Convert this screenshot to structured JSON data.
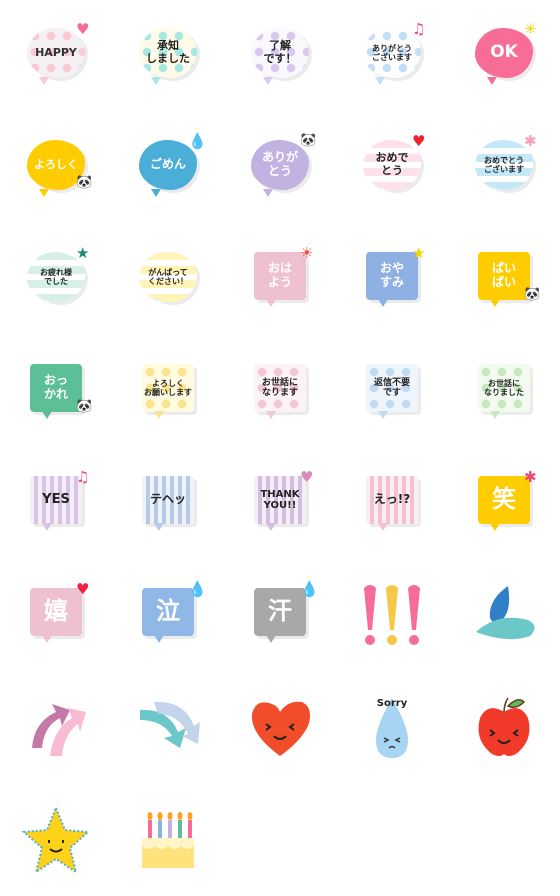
{
  "stickers": [
    {
      "lines": [
        "HAPPY"
      ],
      "shape": "cloud",
      "bg": "#f4f0f4",
      "dot": "#f9c9d4",
      "fg": "#333333",
      "size": 11,
      "pattern": "dots",
      "deco": "heart-icon",
      "decoColor": "#f56b9a"
    },
    {
      "lines": [
        "承知",
        "しました"
      ],
      "shape": "cloud",
      "bg": "#fffbe8",
      "dot": "#a8e8e4",
      "fg": "#222222",
      "size": 11,
      "pattern": "dots",
      "deco": "",
      "decoColor": ""
    },
    {
      "lines": [
        "了解",
        "です！"
      ],
      "shape": "cloud",
      "bg": "#faf8fc",
      "dot": "#d9c8f0",
      "fg": "#222222",
      "size": 11,
      "pattern": "dots",
      "deco": "",
      "decoColor": ""
    },
    {
      "lines": [
        "ありがとう",
        "ございます"
      ],
      "shape": "cloud",
      "bg": "#ffffff",
      "dot": "#c3def7",
      "fg": "#222222",
      "size": 8,
      "pattern": "dots",
      "deco": "music-note-icon",
      "decoColor": "#f0457a"
    },
    {
      "lines": [
        "OK"
      ],
      "shape": "cloud",
      "bg": "#f76d98",
      "dot": "",
      "fg": "#ffffff",
      "size": 17,
      "pattern": "solid",
      "deco": "sparkle-icon",
      "decoColor": "#f5d400"
    },
    {
      "lines": [
        "よろしく"
      ],
      "shape": "cloud",
      "bg": "#ffcc00",
      "dot": "",
      "fg": "#ffffff",
      "size": 11,
      "pattern": "solid",
      "deco": "panda-icon",
      "decoColor": "#000000"
    },
    {
      "lines": [
        "ごめん"
      ],
      "shape": "cloud",
      "bg": "#4aaed8",
      "dot": "",
      "fg": "#ffffff",
      "size": 12,
      "pattern": "solid",
      "deco": "sweat-drop-icon",
      "decoColor": "#aaaaaa"
    },
    {
      "lines": [
        "ありが",
        "とう"
      ],
      "shape": "cloud",
      "bg": "#c2b2e2",
      "dot": "",
      "fg": "#ffffff",
      "size": 12,
      "pattern": "solid",
      "deco": "panda-icon",
      "decoColor": "#000000"
    },
    {
      "lines": [
        "おめで",
        "とう"
      ],
      "shape": "cloud",
      "bg": "#fde0ea",
      "dot": "#ffffff",
      "fg": "#222222",
      "size": 11,
      "pattern": "stripes",
      "deco": "heart-icon",
      "decoColor": "#ee2233"
    },
    {
      "lines": [
        "おめでとう",
        "ございます"
      ],
      "shape": "cloud",
      "bg": "#c4e8f7",
      "dot": "#ffffff",
      "fg": "#222222",
      "size": 8,
      "pattern": "stripes",
      "deco": "flower-icon",
      "decoColor": "#f7a0b8"
    },
    {
      "lines": [
        "お疲れ様",
        "でした"
      ],
      "shape": "cloud",
      "bg": "#d6f0e8",
      "dot": "#ffffff",
      "fg": "#222222",
      "size": 8,
      "pattern": "stripes",
      "deco": "star-icon",
      "decoColor": "#1a8a7a"
    },
    {
      "lines": [
        "がんばって",
        "ください！"
      ],
      "shape": "cloud",
      "bg": "#fff4b8",
      "dot": "#ffffff",
      "fg": "#222222",
      "size": 8,
      "pattern": "stripes",
      "deco": "",
      "decoColor": ""
    },
    {
      "lines": [
        "おは",
        "よう"
      ],
      "shape": "square",
      "bg": "#efc0d0",
      "dot": "",
      "fg": "#ffffff",
      "size": 12,
      "pattern": "solid",
      "deco": "sun-icon",
      "decoColor": "#f24d3a"
    },
    {
      "lines": [
        "おや",
        "すみ"
      ],
      "shape": "square",
      "bg": "#8fb0e2",
      "dot": "",
      "fg": "#ffffff",
      "size": 12,
      "pattern": "solid",
      "deco": "star-icon",
      "decoColor": "#f5d400"
    },
    {
      "lines": [
        "ばい",
        "ばい"
      ],
      "shape": "square",
      "bg": "#ffcc00",
      "dot": "",
      "fg": "#ffffff",
      "size": 12,
      "pattern": "solid",
      "deco": "panda-icon",
      "decoColor": "#000000"
    },
    {
      "lines": [
        "おっ",
        "かれ"
      ],
      "shape": "square",
      "bg": "#5cbf95",
      "dot": "",
      "fg": "#ffffff",
      "size": 12,
      "pattern": "solid",
      "deco": "panda-icon",
      "decoColor": "#000000"
    },
    {
      "lines": [
        "よろしく",
        "お願いします"
      ],
      "shape": "square",
      "bg": "#fffbe0",
      "dot": "#fbe38a",
      "fg": "#222222",
      "size": 8,
      "pattern": "dots",
      "deco": "",
      "decoColor": ""
    },
    {
      "lines": [
        "お世話に",
        "なります"
      ],
      "shape": "square",
      "bg": "#fdf2f5",
      "dot": "#f3c7d4",
      "fg": "#222222",
      "size": 9,
      "pattern": "dots",
      "deco": "",
      "decoColor": ""
    },
    {
      "lines": [
        "返信不要",
        "です"
      ],
      "shape": "square",
      "bg": "#eef5fc",
      "dot": "#c3daf3",
      "fg": "#222222",
      "size": 9,
      "pattern": "dots",
      "deco": "",
      "decoColor": ""
    },
    {
      "lines": [
        "お世話に",
        "なりました"
      ],
      "shape": "square",
      "bg": "#f3faf0",
      "dot": "#c8e8c0",
      "fg": "#222222",
      "size": 8,
      "pattern": "dots",
      "deco": "",
      "decoColor": ""
    },
    {
      "lines": [
        "YES"
      ],
      "shape": "square",
      "bg": "#f4eef6",
      "dot": "#d8c2e6",
      "fg": "#222222",
      "size": 13,
      "pattern": "vstripes",
      "deco": "music-note-icon",
      "decoColor": "#f0457a"
    },
    {
      "lines": [
        "テヘッ"
      ],
      "shape": "square",
      "bg": "#eef3fa",
      "dot": "#b8cbe6",
      "fg": "#222222",
      "size": 12,
      "pattern": "vstripes",
      "deco": "",
      "decoColor": ""
    },
    {
      "lines": [
        "THANK",
        "YOU!!"
      ],
      "shape": "square",
      "bg": "#f6eef6",
      "dot": "#d4bedf",
      "fg": "#222222",
      "size": 10,
      "pattern": "vstripes",
      "deco": "heart-icon",
      "decoColor": "#d88ab8"
    },
    {
      "lines": [
        "えっ!?"
      ],
      "shape": "square",
      "bg": "#fbeef2",
      "dot": "#f2c0ce",
      "fg": "#222222",
      "size": 12,
      "pattern": "vstripes",
      "deco": "",
      "decoColor": ""
    },
    {
      "lines": [
        "笑"
      ],
      "shape": "square",
      "bg": "#ffcc00",
      "dot": "",
      "fg": "#ffffff",
      "size": 24,
      "pattern": "solid",
      "deco": "flower-icon",
      "decoColor": "#f0457a"
    },
    {
      "lines": [
        "嬉"
      ],
      "shape": "square",
      "bg": "#efc0d0",
      "dot": "",
      "fg": "#ffffff",
      "size": 24,
      "pattern": "solid",
      "deco": "heart-icon",
      "decoColor": "#ee2244"
    },
    {
      "lines": [
        "泣"
      ],
      "shape": "square",
      "bg": "#8fb8e6",
      "dot": "",
      "fg": "#ffffff",
      "size": 24,
      "pattern": "solid",
      "deco": "tear-drop-icon",
      "decoColor": "#3a7ad8"
    },
    {
      "lines": [
        "汗"
      ],
      "shape": "square",
      "bg": "#a8a8a8",
      "dot": "",
      "fg": "#ffffff",
      "size": 24,
      "pattern": "solid",
      "deco": "sweat-drop-icon",
      "decoColor": "#3a7ad8"
    },
    {
      "kind": "exclamation",
      "icon": "exclamation-marks-icon",
      "colors": [
        "#f76d98",
        "#f5c84a",
        "#f76d98"
      ]
    },
    {
      "kind": "drops",
      "icon": "water-drops-icon",
      "colors": [
        "#2f80c8",
        "#6cc8c8"
      ]
    },
    {
      "kind": "arrow-up",
      "icon": "curved-arrow-up-icon",
      "colors": [
        "#c47aa8",
        "#f7bcd4"
      ]
    },
    {
      "kind": "arrow-down",
      "icon": "curved-arrow-down-icon",
      "colors": [
        "#6cc8c8",
        "#b8cde8"
      ]
    },
    {
      "kind": "heart-face",
      "icon": "smiling-heart-icon",
      "colors": [
        "#f24d2a"
      ]
    },
    {
      "kind": "sorry-drop",
      "icon": "sorry-drop-icon",
      "text": "Sorry",
      "colors": [
        "#a8d4f4"
      ]
    },
    {
      "kind": "apple",
      "icon": "smiling-apple-icon",
      "colors": [
        "#f23a2a",
        "#5cb85c"
      ]
    },
    {
      "kind": "star",
      "icon": "smiling-star-icon",
      "colors": [
        "#ffd21a",
        "#4aaed8"
      ]
    },
    {
      "kind": "cake",
      "icon": "birthday-cake-icon",
      "colors": [
        "#ffe27a",
        "#fff6c8",
        "#f76d98"
      ]
    }
  ]
}
